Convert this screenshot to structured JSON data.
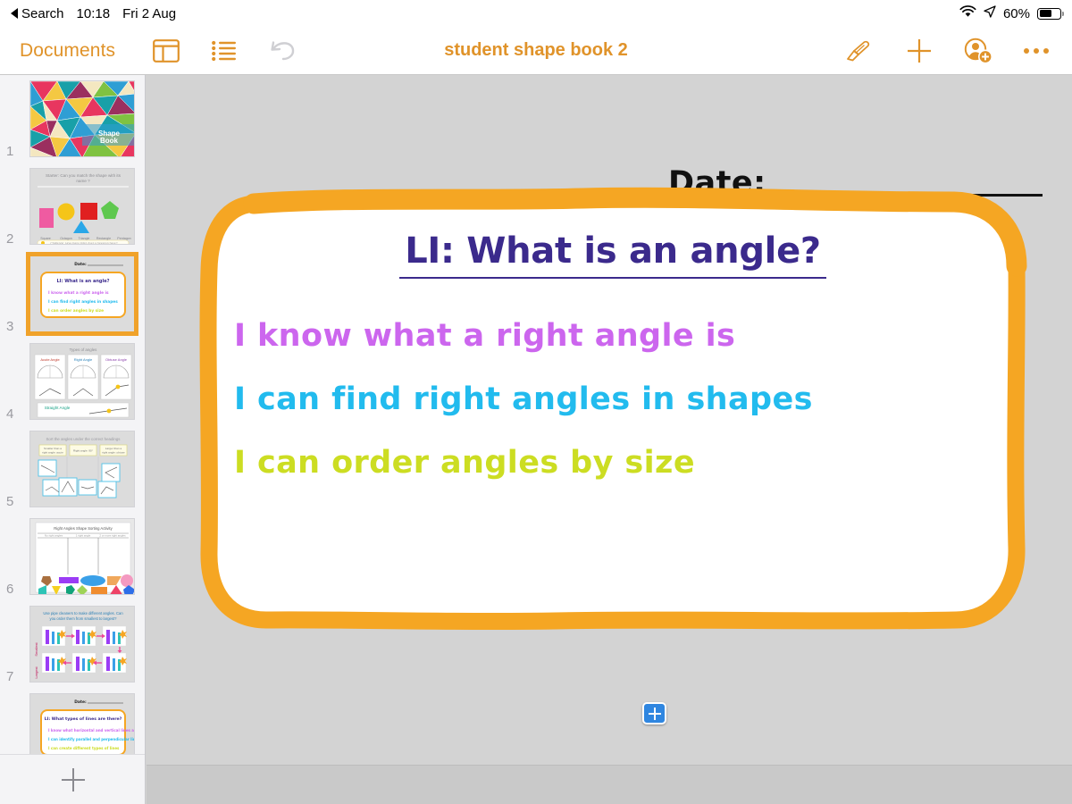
{
  "status_bar": {
    "back_label": "Search",
    "time": "10:18",
    "date": "Fri 2 Aug",
    "battery_percent": "60%",
    "battery_level": 60,
    "icons": [
      "wifi-icon",
      "location-arrow-icon",
      "battery-icon"
    ]
  },
  "toolbar": {
    "documents_label": "Documents",
    "title": "student shape book 2",
    "left_icons": [
      "sidebar-layout-icon",
      "list-view-icon",
      "undo-icon"
    ],
    "right_icons": [
      "format-brush-icon",
      "insert-plus-icon",
      "add-collaborator-icon",
      "more-options-icon"
    ],
    "accent_color": "#e0932a",
    "undo_disabled": true
  },
  "sidebar": {
    "add_slide_label": "+",
    "selected_slide": 3,
    "slides": [
      {
        "number": "1",
        "title": "Shape Book",
        "kind": "mosaic-cover"
      },
      {
        "number": "2",
        "title": "Starter: Can you match the shape with its name?",
        "kind": "shape-match",
        "shape_labels": [
          "Square",
          "Octagon",
          "Triangle",
          "Rectangle",
          "Pentagon"
        ],
        "footer": "Challenge: How many sides does a hexagon have?"
      },
      {
        "number": "3",
        "title": "LI: What is an angle?",
        "kind": "learning-intention",
        "date_label": "Date:",
        "bullets": [
          "I know what a right angle is",
          "I can find right angles in shapes",
          "I can order angles by size"
        ]
      },
      {
        "number": "4",
        "title": "Types of angles",
        "kind": "angle-types",
        "cards": [
          "Acute Angle",
          "Right Angle",
          "Obtuse Angle"
        ],
        "footer": "Straight Angle"
      },
      {
        "number": "5",
        "title": "Sort the angles under the correct headings",
        "kind": "angle-sort",
        "headings": [
          "Smaller than a right angle: acute",
          "Right angle: 90°",
          "Larger than a right angle: obtuse"
        ]
      },
      {
        "number": "6",
        "title": "Right Angles Shape Sorting Activity",
        "kind": "shape-sort",
        "headings": [
          "No right angles",
          "1 right angle",
          "2 or more right angles"
        ]
      },
      {
        "number": "7",
        "title": "Use pipe cleaners to make different angles. Can you order them from smallest to largest?",
        "kind": "pipe-cleaners",
        "side_labels": [
          "Smallest",
          "Largest"
        ]
      },
      {
        "number": "8",
        "title": "LI: What types of lines are there?",
        "kind": "learning-intention",
        "date_label": "Date:",
        "bullets": [
          "I know what horizontal and vertical lines are",
          "I can identify parallel and perpendicular lines",
          "I can create different types of lines"
        ]
      }
    ]
  },
  "slide": {
    "date_label": "Date:",
    "heading": "LI: What is an angle?",
    "heading_color": "#3b2a8c",
    "frame_color": "#f5a623",
    "bullets": [
      {
        "text": "I know what a right angle is",
        "color": "#cc66ee"
      },
      {
        "text": "I can find right angles in shapes",
        "color": "#22bbee"
      },
      {
        "text": "I can order angles by size",
        "color": "#ccdd22"
      }
    ],
    "add_text_handle": "+"
  }
}
